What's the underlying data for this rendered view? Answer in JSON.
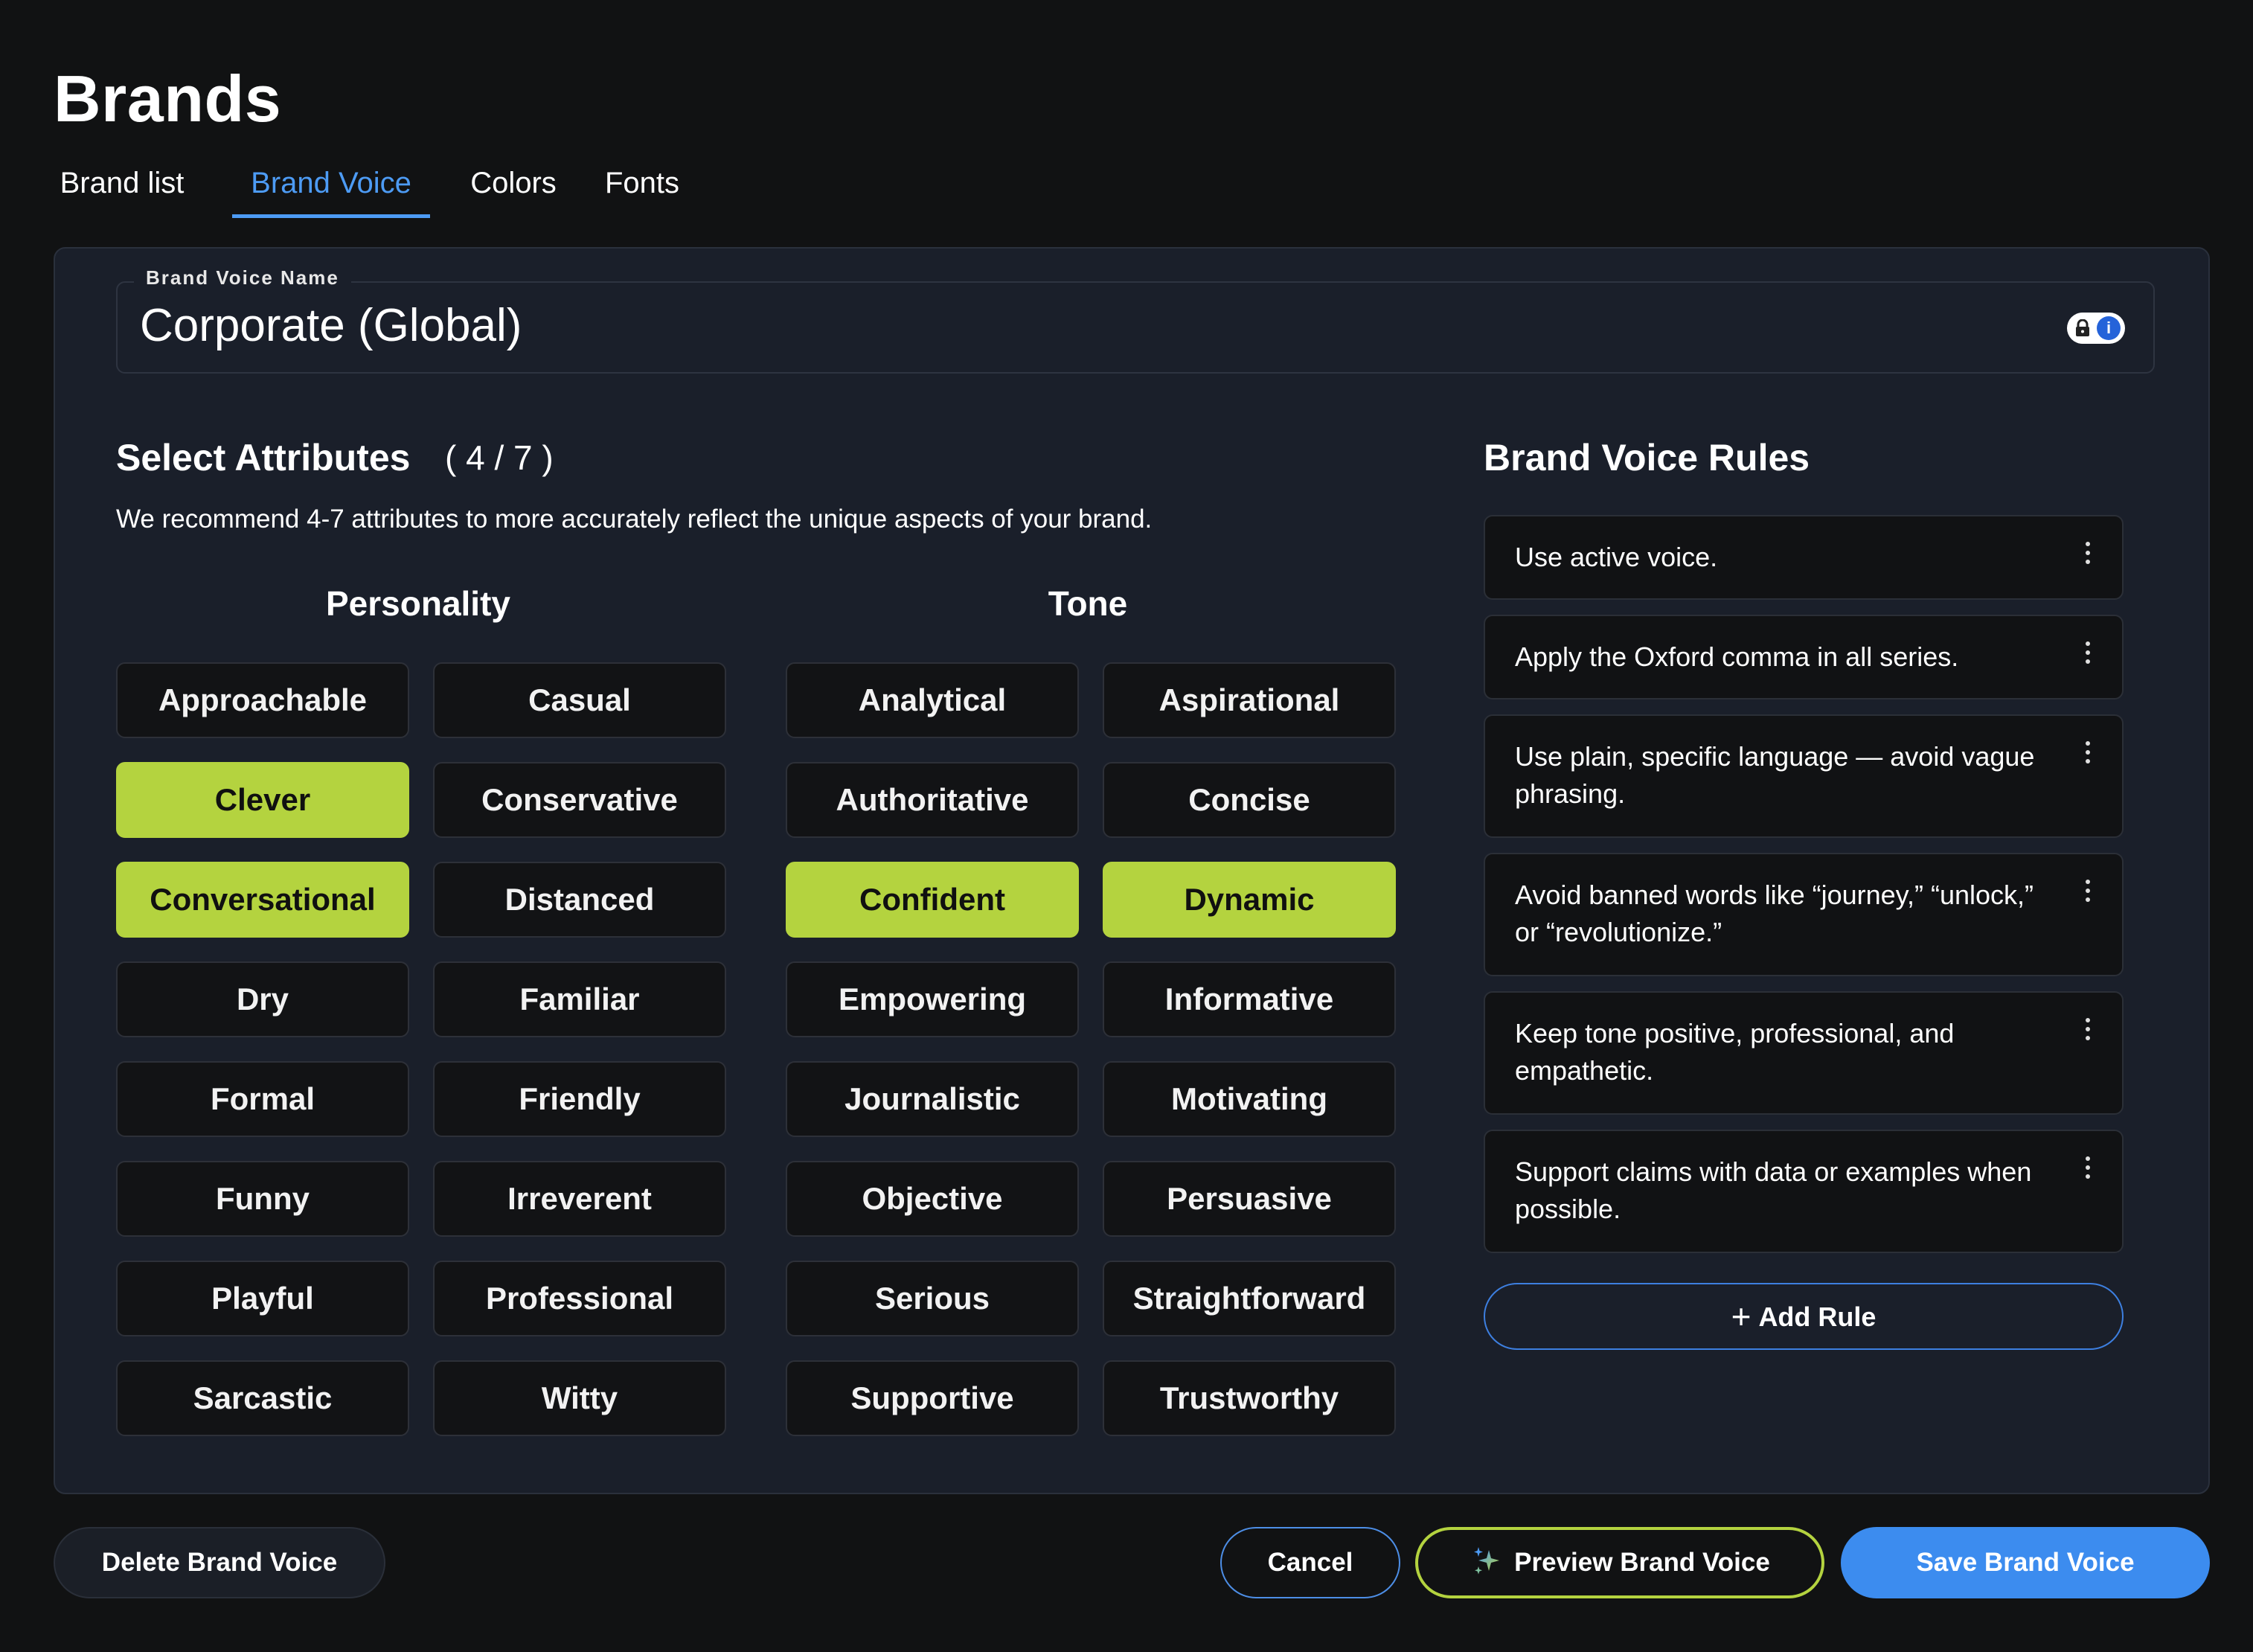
{
  "page": {
    "title": "Brands"
  },
  "tabs": [
    {
      "label": "Brand list"
    },
    {
      "label": "Brand Voice",
      "active": true
    },
    {
      "label": "Colors"
    },
    {
      "label": "Fonts"
    }
  ],
  "name_field": {
    "label": "Brand Voice Name",
    "value": "Corporate (Global)"
  },
  "attributes": {
    "title": "Select Attributes",
    "count": "( 4 / 7 )",
    "description": "We recommend 4-7 attributes to more accurately reflect the unique aspects of your brand.",
    "personality": {
      "heading": "Personality",
      "items": [
        {
          "label": "Approachable",
          "selected": false
        },
        {
          "label": "Casual",
          "selected": false
        },
        {
          "label": "Clever",
          "selected": true
        },
        {
          "label": "Conservative",
          "selected": false
        },
        {
          "label": "Conversational",
          "selected": true
        },
        {
          "label": "Distanced",
          "selected": false
        },
        {
          "label": "Dry",
          "selected": false
        },
        {
          "label": "Familiar",
          "selected": false
        },
        {
          "label": "Formal",
          "selected": false
        },
        {
          "label": "Friendly",
          "selected": false
        },
        {
          "label": "Funny",
          "selected": false
        },
        {
          "label": "Irreverent",
          "selected": false
        },
        {
          "label": "Playful",
          "selected": false
        },
        {
          "label": "Professional",
          "selected": false
        },
        {
          "label": "Sarcastic",
          "selected": false
        },
        {
          "label": "Witty",
          "selected": false
        }
      ]
    },
    "tone": {
      "heading": "Tone",
      "items": [
        {
          "label": "Analytical",
          "selected": false
        },
        {
          "label": "Aspirational",
          "selected": false
        },
        {
          "label": "Authoritative",
          "selected": false
        },
        {
          "label": "Concise",
          "selected": false
        },
        {
          "label": "Confident",
          "selected": true
        },
        {
          "label": "Dynamic",
          "selected": true
        },
        {
          "label": "Empowering",
          "selected": false
        },
        {
          "label": "Informative",
          "selected": false
        },
        {
          "label": "Journalistic",
          "selected": false
        },
        {
          "label": "Motivating",
          "selected": false
        },
        {
          "label": "Objective",
          "selected": false
        },
        {
          "label": "Persuasive",
          "selected": false
        },
        {
          "label": "Serious",
          "selected": false
        },
        {
          "label": "Straightforward",
          "selected": false
        },
        {
          "label": "Supportive",
          "selected": false
        },
        {
          "label": "Trustworthy",
          "selected": false
        }
      ]
    }
  },
  "rules": {
    "title": "Brand Voice Rules",
    "items": [
      {
        "text": "Use active voice."
      },
      {
        "text": "Apply the Oxford comma in all series."
      },
      {
        "text": "Use plain, specific language — avoid vague phrasing."
      },
      {
        "text": "Avoid banned words like “journey,” “unlock,” or “revolutionize.”"
      },
      {
        "text": "Keep tone positive, professional, and empathetic."
      },
      {
        "text": "Support claims with data or examples when possible."
      }
    ],
    "add_label": "Add Rule"
  },
  "footer": {
    "delete_label": "Delete Brand Voice",
    "cancel_label": "Cancel",
    "preview_label": "Preview Brand Voice",
    "save_label": "Save Brand Voice"
  },
  "colors": {
    "accent_blue": "#3c8cef",
    "selected_green": "#b4d33f",
    "background": "#111213",
    "card": "#1a1f2a"
  },
  "icons": [
    "lock-icon",
    "info-icon",
    "more-vertical-icon",
    "plus-icon",
    "sparkle-icon"
  ]
}
